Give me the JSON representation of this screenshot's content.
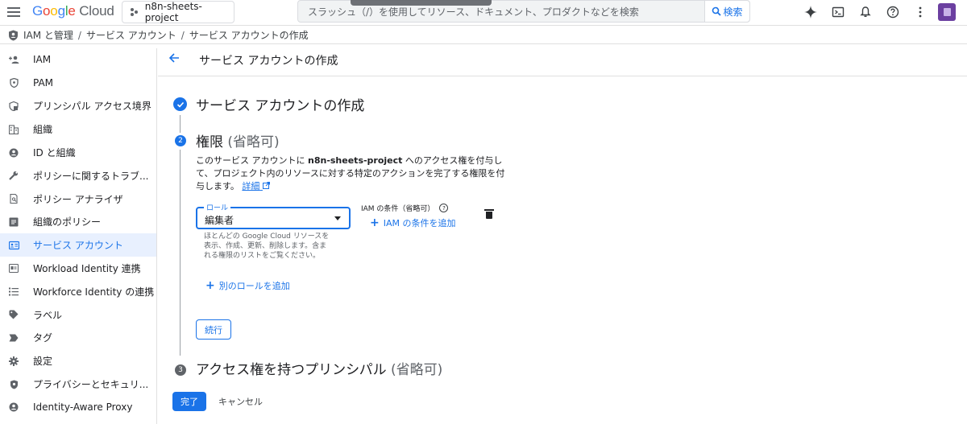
{
  "topbar": {
    "logo": {
      "g": "G",
      "o1": "o",
      "o2": "o",
      "g2": "g",
      "l": "l",
      "e": "e",
      "cloud": "Cloud"
    },
    "project": "n8n-sheets-project",
    "search_placeholder": "スラッシュ（/）を使用してリソース、ドキュメント、プロダクトなどを検索",
    "search_button": "検索",
    "icons": [
      "gemini-icon",
      "cloud-shell-icon",
      "notifications-icon",
      "help-icon",
      "more-icon"
    ]
  },
  "breadcrumb": [
    "IAM と管理",
    "サービス アカウント",
    "サービス アカウントの作成"
  ],
  "sidebar": {
    "items": [
      {
        "label": "IAM",
        "icon": "person-add-icon"
      },
      {
        "label": "PAM",
        "icon": "shield-icon"
      },
      {
        "label": "プリンシパル アクセス境界",
        "icon": "boundary-icon"
      },
      {
        "label": "組織",
        "icon": "building-icon"
      },
      {
        "label": "ID と組織",
        "icon": "account-circle-icon"
      },
      {
        "label": "ポリシーに関するトラブ...",
        "icon": "wrench-icon"
      },
      {
        "label": "ポリシー アナライザ",
        "icon": "policy-search-icon"
      },
      {
        "label": "組織のポリシー",
        "icon": "list-box-icon"
      },
      {
        "label": "サービス アカウント",
        "icon": "service-account-icon",
        "active": true
      },
      {
        "label": "Workload Identity 連携",
        "icon": "id-card-icon"
      },
      {
        "label": "Workforce Identity の連携",
        "icon": "list-icon"
      },
      {
        "label": "ラベル",
        "icon": "label-icon"
      },
      {
        "label": "タグ",
        "icon": "tag-icon"
      },
      {
        "label": "設定",
        "icon": "settings-icon"
      },
      {
        "label": "プライバシーとセキュリ...",
        "icon": "privacy-shield-icon"
      },
      {
        "label": "Identity-Aware Proxy",
        "icon": "iap-icon"
      }
    ]
  },
  "page": {
    "title": "サービス アカウントの作成",
    "step1": {
      "title": "サービス アカウントの作成"
    },
    "step2": {
      "number": "2",
      "title": "権限",
      "optional": "(省略可)",
      "desc_pre": "このサービス アカウントに ",
      "desc_project": "n8n-sheets-project",
      "desc_post": " へのアクセス権を付与して、プロジェクト内のリソースに対する特定のアクションを完了する権限を付与します。",
      "details_link": "詳細",
      "role_label": "ロール",
      "role_value": "編集者",
      "role_help": "ほとんどの Google Cloud リソースを表示、作成、更新、削除します。含まれる権限のリストをご覧ください。",
      "iam_condition_label": "IAM の条件（省略可）",
      "add_condition": "IAM の条件を追加",
      "add_role": "別のロールを追加",
      "continue": "続行"
    },
    "step3": {
      "number": "3",
      "title": "アクセス権を持つプリンシパル",
      "optional": "(省略可)"
    },
    "done": "完了",
    "cancel": "キャンセル"
  },
  "colors": {
    "accent": "#1a73e8",
    "active_bg": "#e8f0fe"
  }
}
